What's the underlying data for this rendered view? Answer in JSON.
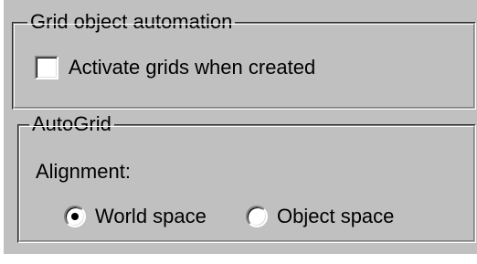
{
  "grid_object_automation": {
    "title": "Grid object automation",
    "activate_grids_label": "Activate grids when created",
    "activate_grids_checked": false
  },
  "autogrid": {
    "title": "AutoGrid",
    "alignment_label": "Alignment:",
    "options": [
      {
        "label": "World space",
        "selected": true
      },
      {
        "label": "Object space",
        "selected": false
      }
    ]
  },
  "colors": {
    "panel_background": "#c0c0c0",
    "field_background": "#ffffff",
    "shadow": "#808080",
    "highlight": "#ffffff"
  }
}
